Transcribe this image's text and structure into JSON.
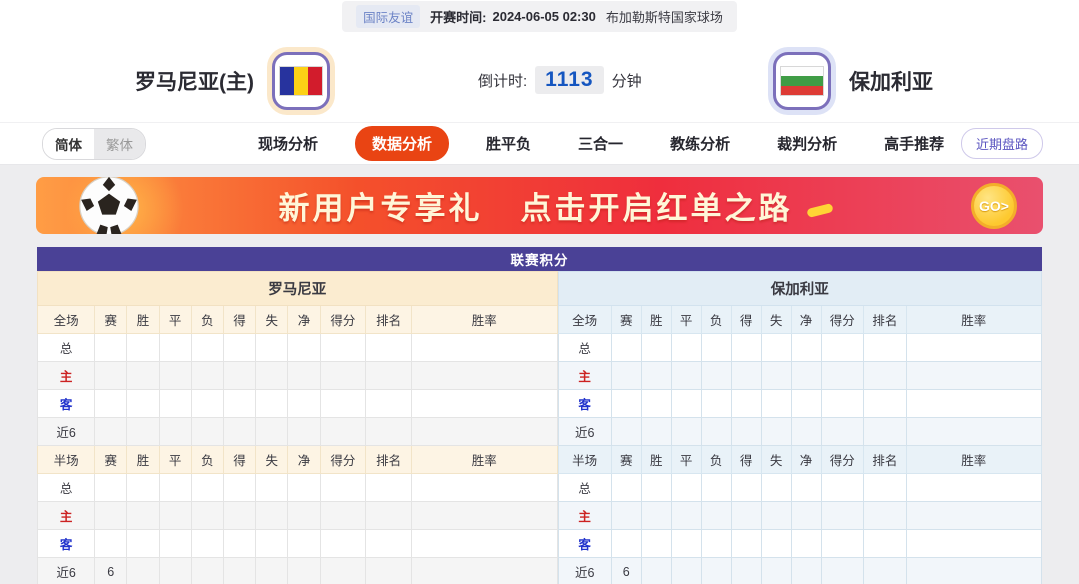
{
  "top_bar": {
    "league_badge": "国际友谊",
    "kickoff_label": "开赛时间:",
    "kickoff_time": "2024-06-05 02:30",
    "venue": "布加勒斯特国家球场"
  },
  "header": {
    "home_name": "罗马尼亚(主)",
    "away_name": "保加利亚",
    "countdown_label": "倒计时:",
    "countdown_value": "1113",
    "countdown_unit": "分钟"
  },
  "nav": {
    "lang": [
      {
        "label": "简体",
        "active": true
      },
      {
        "label": "繁体",
        "active": false
      }
    ],
    "tabs": [
      {
        "label": "现场分析",
        "active": false
      },
      {
        "label": "数据分析",
        "active": true
      },
      {
        "label": "胜平负",
        "active": false
      },
      {
        "label": "三合一",
        "active": false
      },
      {
        "label": "教练分析",
        "active": false
      },
      {
        "label": "裁判分析",
        "active": false
      },
      {
        "label": "高手推荐",
        "active": false
      }
    ],
    "recent_button": "近期盘路"
  },
  "banner": {
    "title": "新用户专享礼",
    "subtitle": "点击开启红单之路",
    "go_label": "GO>"
  },
  "table": {
    "title": "联赛积分",
    "stat_columns": [
      "赛",
      "胜",
      "平",
      "负",
      "得",
      "失",
      "净",
      "得分",
      "排名",
      "胜率"
    ],
    "teams": [
      {
        "name": "罗马尼亚",
        "theme": "cream",
        "sections": [
          {
            "first_col": "全场",
            "rows": [
              {
                "label": "总",
                "type": "total",
                "cells": [
                  "",
                  "",
                  "",
                  "",
                  "",
                  "",
                  "",
                  "",
                  "",
                  ""
                ]
              },
              {
                "label": "主",
                "type": "home",
                "cells": [
                  "",
                  "",
                  "",
                  "",
                  "",
                  "",
                  "",
                  "",
                  "",
                  ""
                ]
              },
              {
                "label": "客",
                "type": "away",
                "cells": [
                  "",
                  "",
                  "",
                  "",
                  "",
                  "",
                  "",
                  "",
                  "",
                  ""
                ]
              },
              {
                "label": "近6",
                "type": "recent",
                "cells": [
                  "",
                  "",
                  "",
                  "",
                  "",
                  "",
                  "",
                  "",
                  "",
                  ""
                ]
              }
            ]
          },
          {
            "first_col": "半场",
            "rows": [
              {
                "label": "总",
                "type": "total",
                "cells": [
                  "",
                  "",
                  "",
                  "",
                  "",
                  "",
                  "",
                  "",
                  "",
                  ""
                ]
              },
              {
                "label": "主",
                "type": "home",
                "cells": [
                  "",
                  "",
                  "",
                  "",
                  "",
                  "",
                  "",
                  "",
                  "",
                  ""
                ]
              },
              {
                "label": "客",
                "type": "away",
                "cells": [
                  "",
                  "",
                  "",
                  "",
                  "",
                  "",
                  "",
                  "",
                  "",
                  ""
                ]
              },
              {
                "label": "近6",
                "type": "recent",
                "cells": [
                  "6",
                  "",
                  "",
                  "",
                  "",
                  "",
                  "",
                  "",
                  "",
                  ""
                ]
              }
            ]
          }
        ]
      },
      {
        "name": "保加利亚",
        "theme": "blue",
        "sections": [
          {
            "first_col": "全场",
            "rows": [
              {
                "label": "总",
                "type": "total",
                "cells": [
                  "",
                  "",
                  "",
                  "",
                  "",
                  "",
                  "",
                  "",
                  "",
                  ""
                ]
              },
              {
                "label": "主",
                "type": "home",
                "cells": [
                  "",
                  "",
                  "",
                  "",
                  "",
                  "",
                  "",
                  "",
                  "",
                  ""
                ]
              },
              {
                "label": "客",
                "type": "away",
                "cells": [
                  "",
                  "",
                  "",
                  "",
                  "",
                  "",
                  "",
                  "",
                  "",
                  ""
                ]
              },
              {
                "label": "近6",
                "type": "recent",
                "cells": [
                  "",
                  "",
                  "",
                  "",
                  "",
                  "",
                  "",
                  "",
                  "",
                  ""
                ]
              }
            ]
          },
          {
            "first_col": "半场",
            "rows": [
              {
                "label": "总",
                "type": "total",
                "cells": [
                  "",
                  "",
                  "",
                  "",
                  "",
                  "",
                  "",
                  "",
                  "",
                  ""
                ]
              },
              {
                "label": "主",
                "type": "home",
                "cells": [
                  "",
                  "",
                  "",
                  "",
                  "",
                  "",
                  "",
                  "",
                  "",
                  ""
                ]
              },
              {
                "label": "客",
                "type": "away",
                "cells": [
                  "",
                  "",
                  "",
                  "",
                  "",
                  "",
                  "",
                  "",
                  "",
                  ""
                ]
              },
              {
                "label": "近6",
                "type": "recent",
                "cells": [
                  "6",
                  "",
                  "",
                  "",
                  "",
                  "",
                  "",
                  "",
                  "",
                  ""
                ]
              }
            ]
          }
        ]
      }
    ]
  },
  "colors": {
    "table_header_purple": "#4a4196",
    "active_tab_red": "#e94413",
    "countdown_blue": "#1556c0",
    "home_row_label_red": "#cc2222",
    "away_row_label_blue": "#2233cc",
    "banner_gold": "#fdc92f"
  }
}
